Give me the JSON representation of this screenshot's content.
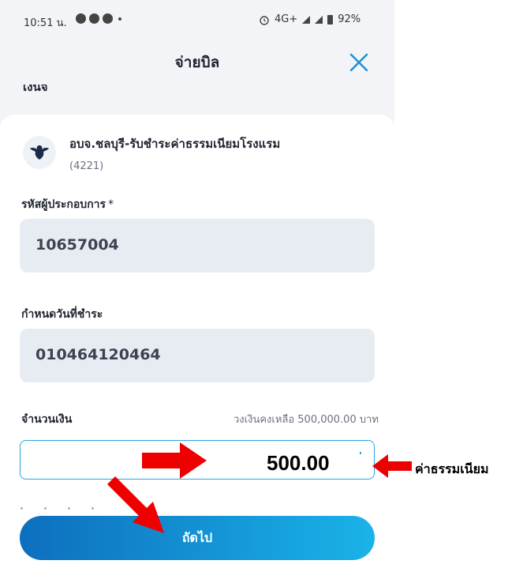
{
  "status_bar": {
    "time": "10:51 น.",
    "network": "4G+",
    "battery": "92%"
  },
  "header": {
    "title": "จ่ายบิล",
    "close_icon": "close-icon"
  },
  "cut_off_text": "เงนจ",
  "biller": {
    "name": "อบจ.ชลบุรี-รับชำระค่าธรรมเนียมโรงแรม",
    "code": "(4221)",
    "logo_icon": "garuda-emblem-icon"
  },
  "fields": {
    "ref1": {
      "label": "รหัสผู้ประกอบการ",
      "required_mark": "*",
      "value": "10657004"
    },
    "ref2": {
      "label": "กำหนดวันที่ชำระ",
      "value": "010464120464"
    },
    "amount": {
      "label": "จำนวนเงิน",
      "hint": "วงเงินคงเหลือ 500,000.00 บาท",
      "value": "500.00"
    }
  },
  "next_button": {
    "label": "ถัดไป"
  },
  "annotation": {
    "fee_label": "ค่าธรรมเนียม",
    "arrow_color": "#ee0000"
  },
  "colors": {
    "accent": "#27a4dd",
    "button_start": "#0d6fbe",
    "button_end": "#1ab3e8",
    "field_bg": "#e7ecf3"
  }
}
